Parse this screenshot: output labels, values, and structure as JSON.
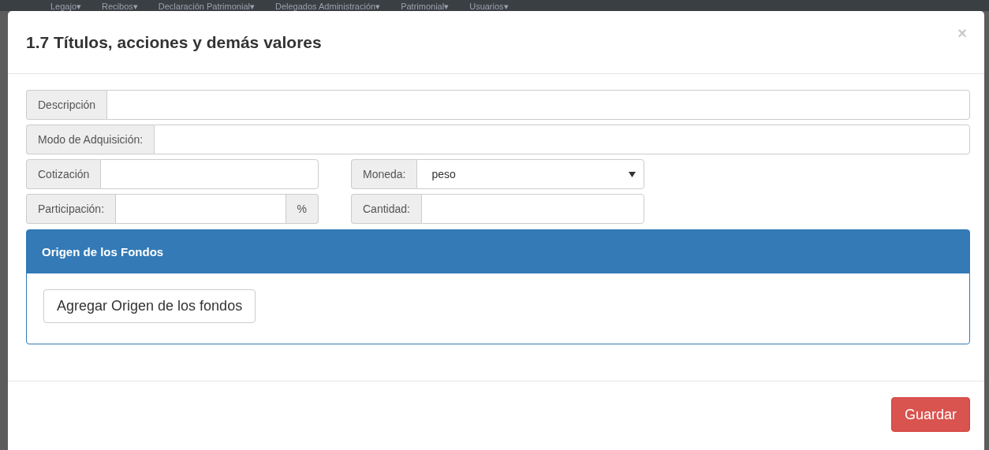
{
  "navbar": {
    "items": [
      "Legajo▾",
      "Recibos▾",
      "Declaración Patrimonial▾",
      "Delegados Administración▾",
      "Patrimonial▾",
      "Usuarios▾"
    ]
  },
  "modal": {
    "title": "1.7 Títulos, acciones y demás valores",
    "close": "×",
    "rows": [
      {
        "fields": [
          {
            "kind": "text",
            "label": "Descripción"
          }
        ]
      },
      {
        "fields": [
          {
            "kind": "text",
            "label": "Modo de Adquisición:"
          }
        ]
      },
      {
        "fields": [
          {
            "kind": "text",
            "label": "Cotización"
          },
          {
            "kind": "select",
            "label": "Moneda:",
            "value": "peso"
          }
        ]
      },
      {
        "fields": [
          {
            "kind": "addon",
            "label": "Participación:",
            "addon": "%"
          },
          {
            "kind": "text",
            "label": "Cantidad:"
          }
        ]
      }
    ],
    "panel": {
      "title": "Origen de los Fondos",
      "button": "Agregar Origen de los fondos"
    },
    "footer": {
      "button": "Guardar"
    }
  }
}
